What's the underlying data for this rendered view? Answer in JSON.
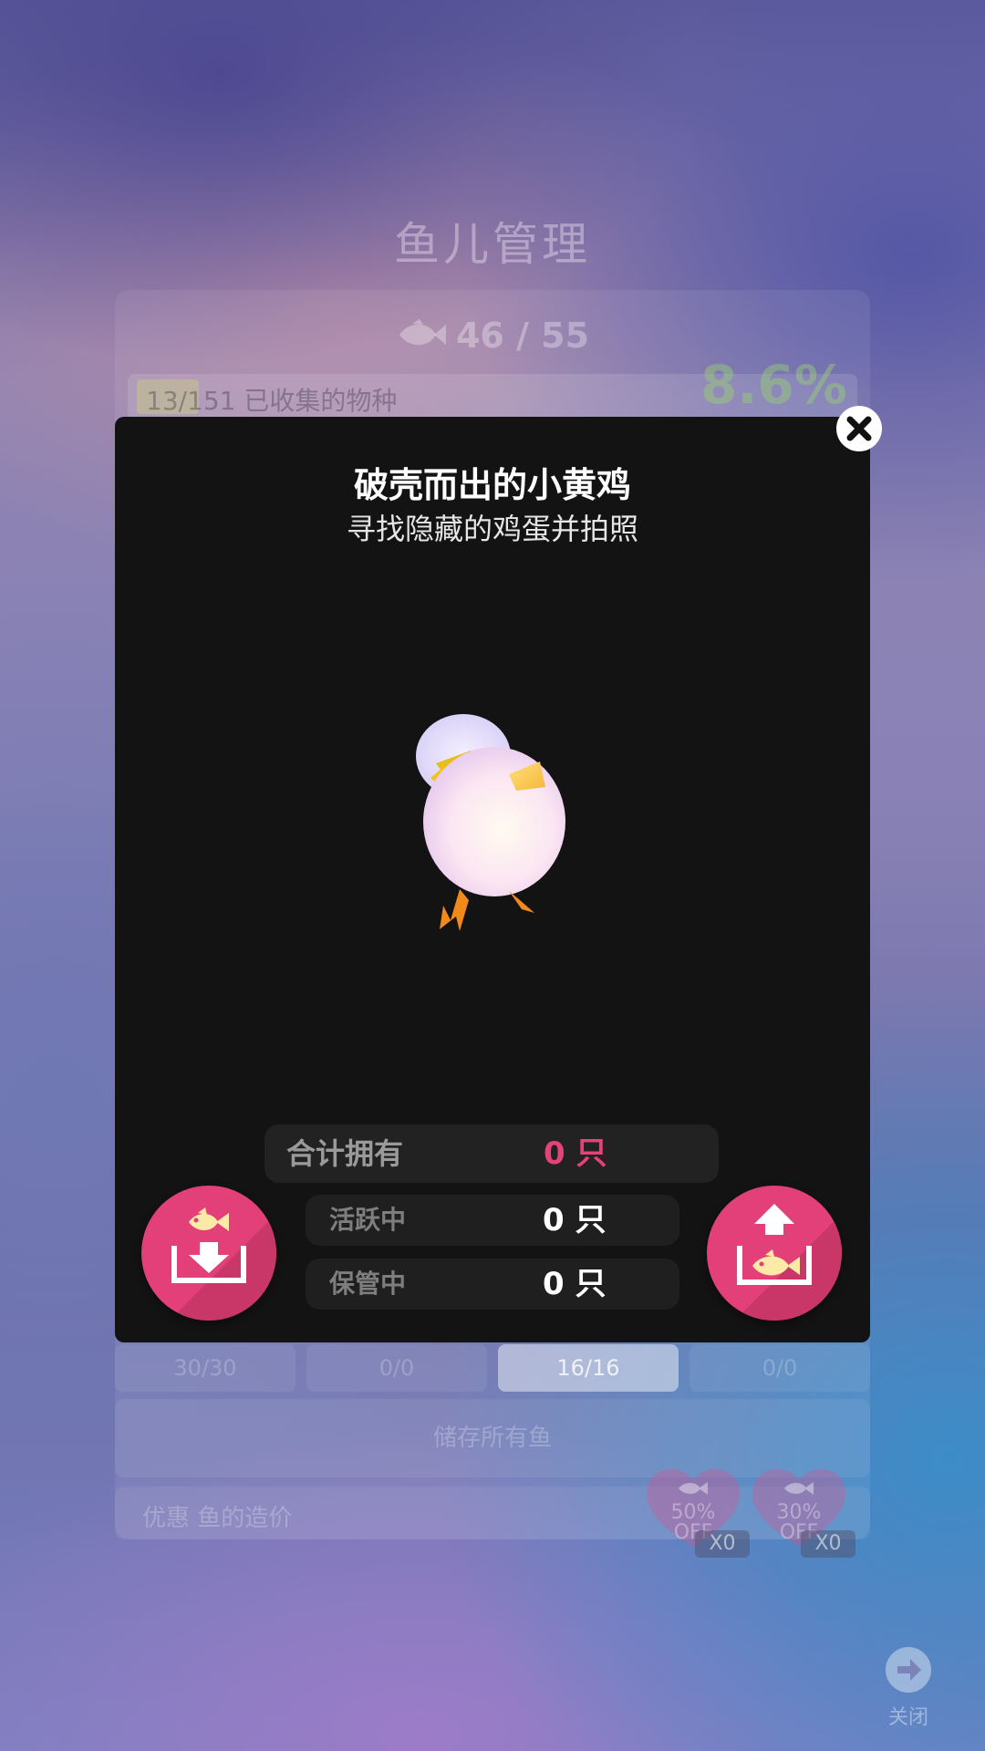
{
  "background": {
    "title": "鱼儿管理",
    "fish_count": "46 / 55",
    "collection_text": "13/151 已收集的物种",
    "collection_percent": "8.6%",
    "collection_progress": 0.086,
    "tabs": [
      {
        "label": "30/30",
        "active": false
      },
      {
        "label": "0/0",
        "active": false
      },
      {
        "label": "16/16",
        "active": true
      },
      {
        "label": "0/0",
        "active": false
      }
    ],
    "store_all_label": "储存所有鱼",
    "discount_label": "优惠 鱼的造价",
    "coupons": [
      {
        "percent": "50%",
        "off": "OFF",
        "count": "X0"
      },
      {
        "percent": "30%",
        "off": "OFF",
        "count": "X0"
      }
    ],
    "close_label": "关闭"
  },
  "modal": {
    "title": "破壳而出的小黄鸡",
    "subtitle": "寻找隐藏的鸡蛋并拍照",
    "stats": {
      "total_label": "合计拥有",
      "total_value": "0 只",
      "active_label": "活跃中",
      "active_value": "0 只",
      "stored_label": "保管中",
      "stored_value": "0 只"
    }
  },
  "colors": {
    "accent": "#e33f78",
    "accent_text": "#e4427a",
    "modal_bg": "#131313"
  },
  "icons": [
    "close-icon",
    "fish-icon",
    "store-fish-icon",
    "release-fish-icon",
    "arrow-right-icon",
    "heart-coupon-icon",
    "chick-model"
  ]
}
